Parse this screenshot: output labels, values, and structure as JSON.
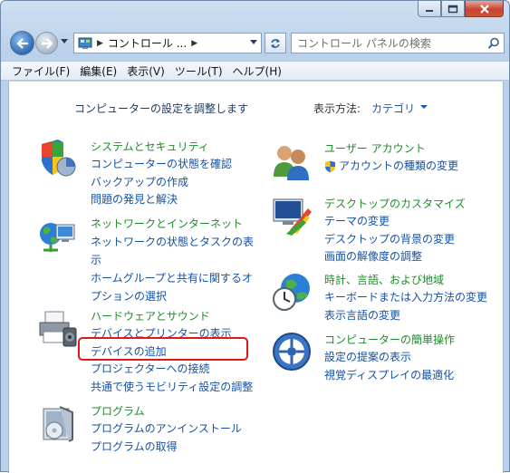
{
  "address": {
    "location": "コントロール ...",
    "search_placeholder": "コントロール パネルの検索"
  },
  "menu": [
    "ファイル(F)",
    "編集(E)",
    "表示(V)",
    "ツール(T)",
    "ヘルプ(H)"
  ],
  "content": {
    "title": "コンピューターの設定を調整します",
    "view_by_label": "表示方法:",
    "view_by_value": "カテゴリ"
  },
  "categories": {
    "system": {
      "title": "システムとセキュリティ",
      "links": [
        "コンピューターの状態を確認",
        "バックアップの作成",
        "問題の発見と解決"
      ]
    },
    "network": {
      "title": "ネットワークとインターネット",
      "links": [
        "ネットワークの状態とタスクの表示",
        "ホームグループと共有に関するオプションの選択"
      ]
    },
    "hardware": {
      "title": "ハードウェアとサウンド",
      "links": [
        "デバイスとプリンターの表示",
        "デバイスの追加",
        "プロジェクターへの接続",
        "共通で使うモビリティ設定の調整"
      ]
    },
    "programs": {
      "title": "プログラム",
      "links": [
        "プログラムのアンインストール",
        "プログラムの取得"
      ]
    },
    "user": {
      "title": "ユーザー アカウント",
      "links": [
        "アカウントの種類の変更"
      ]
    },
    "appearance": {
      "title": "デスクトップのカスタマイズ",
      "links": [
        "テーマの変更",
        "デスクトップの背景の変更",
        "画面の解像度の調整"
      ]
    },
    "clock": {
      "title": "時計、言語、および地域",
      "links": [
        "キーボードまたは入力方法の変更",
        "表示言語の変更"
      ]
    },
    "ease": {
      "title": "コンピューターの簡単操作",
      "links": [
        "設定の提案の表示",
        "視覚ディスプレイの最適化"
      ]
    }
  }
}
